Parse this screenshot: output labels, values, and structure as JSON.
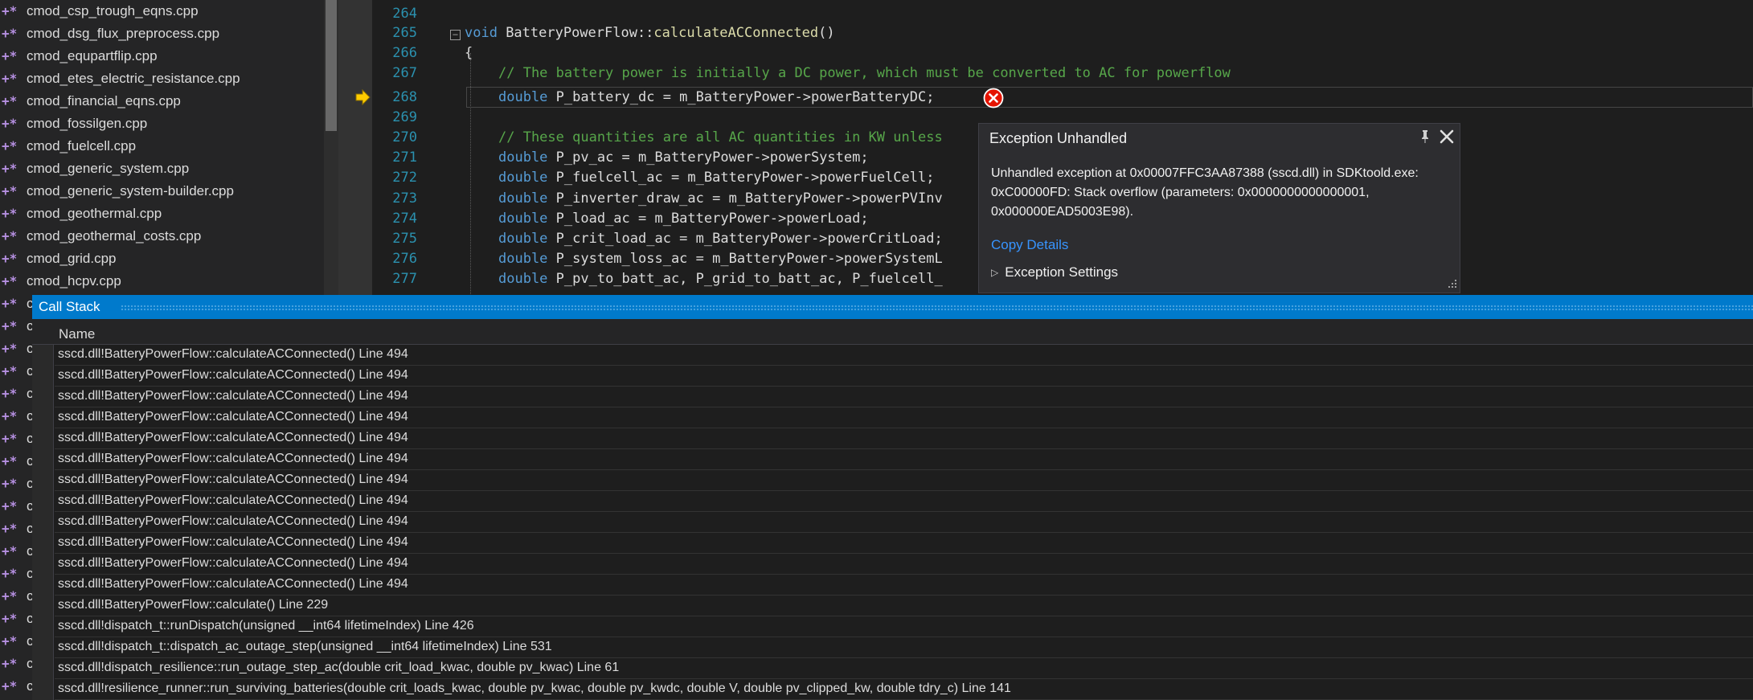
{
  "explorer": {
    "file_icon_glyph": "+*",
    "files": [
      "cmod_csp_trough_eqns.cpp",
      "cmod_dsg_flux_preprocess.cpp",
      "cmod_equpartflip.cpp",
      "cmod_etes_electric_resistance.cpp",
      "cmod_financial_eqns.cpp",
      "cmod_fossilgen.cpp",
      "cmod_fuelcell.cpp",
      "cmod_generic_system.cpp",
      "cmod_generic_system-builder.cpp",
      "cmod_geothermal.cpp",
      "cmod_geothermal_costs.cpp",
      "cmod_grid.cpp",
      "cmod_hcpv.cpp"
    ],
    "obscured_prefix": "c",
    "obscured_row_count": 18
  },
  "editor": {
    "line_numbers": [
      "264",
      "265",
      "266",
      "267",
      "268",
      "269",
      "270",
      "271",
      "272",
      "273",
      "274",
      "275",
      "276",
      "277"
    ],
    "lines": {
      "l264": "",
      "l265_kw": "void",
      "l265_cls": " BatteryPowerFlow::",
      "l265_fn": "calculateACConnected",
      "l265_rest": "()",
      "l266": "{",
      "l267_cm": "// The battery power is initially a DC power, which must be converted to AC for powerflow",
      "l268_kw": "double",
      "l268_rest": " P_battery_dc = m_BatteryPower->powerBatteryDC;",
      "l269": "",
      "l270_cm": "// These quantities are all AC quantities in KW unless",
      "l271_kw": "double",
      "l271_rest": " P_pv_ac = m_BatteryPower->powerSystem;",
      "l272_kw": "double",
      "l272_rest": " P_fuelcell_ac = m_BatteryPower->powerFuelCell;",
      "l273_kw": "double",
      "l273_rest": " P_inverter_draw_ac = m_BatteryPower->powerPVInv",
      "l274_kw": "double",
      "l274_rest": " P_load_ac = m_BatteryPower->powerLoad;",
      "l275_kw": "double",
      "l275_rest": " P_crit_load_ac = m_BatteryPower->powerCritLoad;",
      "l276_kw": "double",
      "l276_rest": " P_system_loss_ac = m_BatteryPower->powerSystemL",
      "l277_kw": "double",
      "l277_rest": " P_pv_to_batt_ac, P_grid_to_batt_ac, P_fuelcell_"
    },
    "collapse_glyph": "−",
    "current_line": "268",
    "colors": {
      "keyword": "#569cd6",
      "function": "#dcdcaa",
      "comment": "#57a64a",
      "line_number": "#2b91af"
    }
  },
  "exception": {
    "title": "Exception Unhandled",
    "pin_glyph": "⊥",
    "message": "Unhandled exception at 0x00007FFC3AA87388 (sscd.dll) in SDKtoold.exe: 0xC00000FD: Stack overflow (parameters: 0x0000000000000001, 0x000000EAD5003E98).",
    "copy_details": "Copy Details",
    "settings_toggle": "▷",
    "settings_label": "Exception Settings"
  },
  "callstack": {
    "title": "Call Stack",
    "column_name": "Name",
    "frames": [
      "sscd.dll!BatteryPowerFlow::calculateACConnected() Line 494",
      "sscd.dll!BatteryPowerFlow::calculateACConnected() Line 494",
      "sscd.dll!BatteryPowerFlow::calculateACConnected() Line 494",
      "sscd.dll!BatteryPowerFlow::calculateACConnected() Line 494",
      "sscd.dll!BatteryPowerFlow::calculateACConnected() Line 494",
      "sscd.dll!BatteryPowerFlow::calculateACConnected() Line 494",
      "sscd.dll!BatteryPowerFlow::calculateACConnected() Line 494",
      "sscd.dll!BatteryPowerFlow::calculateACConnected() Line 494",
      "sscd.dll!BatteryPowerFlow::calculateACConnected() Line 494",
      "sscd.dll!BatteryPowerFlow::calculateACConnected() Line 494",
      "sscd.dll!BatteryPowerFlow::calculateACConnected() Line 494",
      "sscd.dll!BatteryPowerFlow::calculateACConnected() Line 494",
      "sscd.dll!BatteryPowerFlow::calculate() Line 229",
      "sscd.dll!dispatch_t::runDispatch(unsigned __int64 lifetimeIndex) Line 426",
      "sscd.dll!dispatch_t::dispatch_ac_outage_step(unsigned __int64 lifetimeIndex) Line 531",
      "sscd.dll!dispatch_resilience::run_outage_step_ac(double crit_load_kwac, double pv_kwac) Line 61",
      "sscd.dll!resilience_runner::run_surviving_batteries(double crit_loads_kwac, double pv_kwac, double pv_kwdc, double V, double pv_clipped_kw, double tdry_c) Line 141"
    ],
    "accent_color": "#007acc"
  }
}
